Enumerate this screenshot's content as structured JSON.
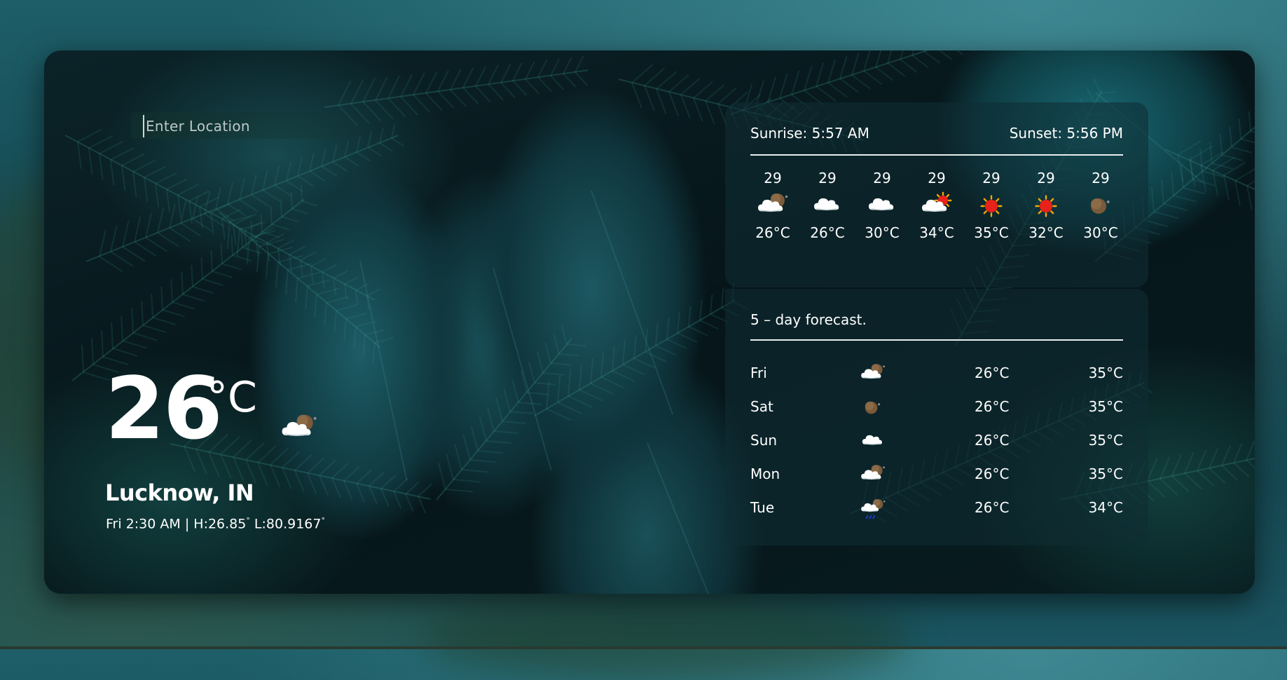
{
  "search": {
    "placeholder": "Enter Location",
    "value": ""
  },
  "current": {
    "temperature": "26",
    "unit": "°C",
    "icon": "cloud-moon-icon",
    "city": "Lucknow, IN",
    "datetime": "Fri 2:30 AM",
    "separator": "|",
    "high_label": "H:26.85",
    "low_label": "L:80.9167",
    "degree_symbol": "°"
  },
  "sun": {
    "sunrise": "Sunrise: 5:57 AM",
    "sunset": "Sunset: 5:56 PM"
  },
  "hourly": [
    {
      "time": "29",
      "icon": "cloud-moon-icon",
      "temp": "26°C"
    },
    {
      "time": "29",
      "icon": "cloud-icon",
      "temp": "26°C"
    },
    {
      "time": "29",
      "icon": "cloud-icon",
      "temp": "30°C"
    },
    {
      "time": "29",
      "icon": "cloud-sun-icon",
      "temp": "34°C"
    },
    {
      "time": "29",
      "icon": "sun-icon",
      "temp": "35°C"
    },
    {
      "time": "29",
      "icon": "sun-icon",
      "temp": "32°C"
    },
    {
      "time": "29",
      "icon": "moon-icon",
      "temp": "30°C"
    }
  ],
  "forecast": {
    "title": "5 – day forecast.",
    "days": [
      {
        "day": "Fri",
        "icon": "cloud-moon-icon",
        "low": "26°C",
        "high": "35°C"
      },
      {
        "day": "Sat",
        "icon": "moon-icon",
        "low": "26°C",
        "high": "35°C"
      },
      {
        "day": "Sun",
        "icon": "cloud-icon",
        "low": "26°C",
        "high": "35°C"
      },
      {
        "day": "Mon",
        "icon": "cloud-moon-icon",
        "low": "26°C",
        "high": "35°C"
      },
      {
        "day": "Tue",
        "icon": "rain-moon-icon",
        "low": "26°C",
        "high": "34°C"
      }
    ]
  },
  "colors": {
    "sun": "#e8211b",
    "sun_rays": "#f6a800",
    "moon": "#7a5a3a",
    "cloud": "#ffffff",
    "panel": "#0f2d34"
  }
}
